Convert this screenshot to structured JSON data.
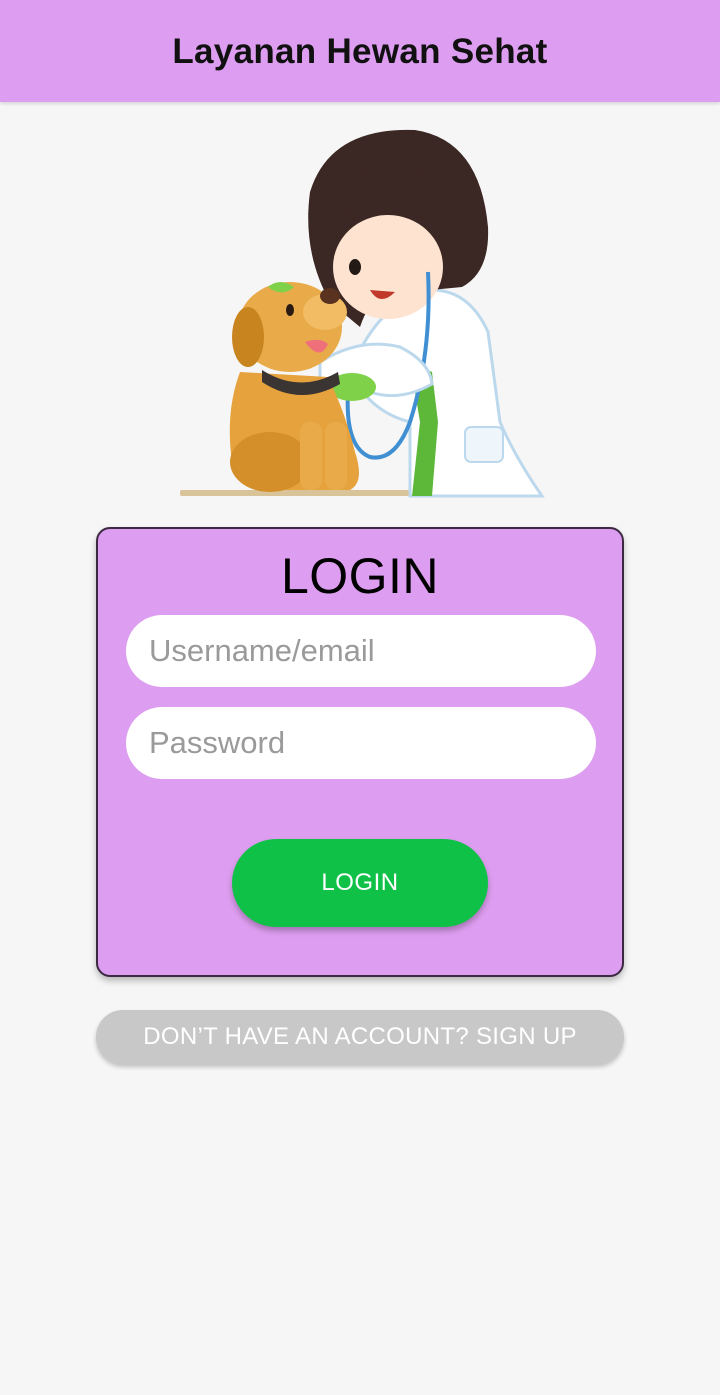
{
  "app_bar": {
    "title": "Layanan Hewan Sehat"
  },
  "hero": {
    "illustration": "vet-with-dog-illustration"
  },
  "login_card": {
    "title": "LOGIN",
    "username": {
      "placeholder": "Username/email",
      "value": ""
    },
    "password": {
      "placeholder": "Password",
      "value": ""
    },
    "submit_label": "LOGIN"
  },
  "signup": {
    "label": "DON’T HAVE AN ACCOUNT? SIGN UP"
  },
  "colors": {
    "accent": "#dd9df0",
    "login_button": "#10c147",
    "signup_button": "#c8c8c8",
    "background": "#f6f6f6"
  }
}
